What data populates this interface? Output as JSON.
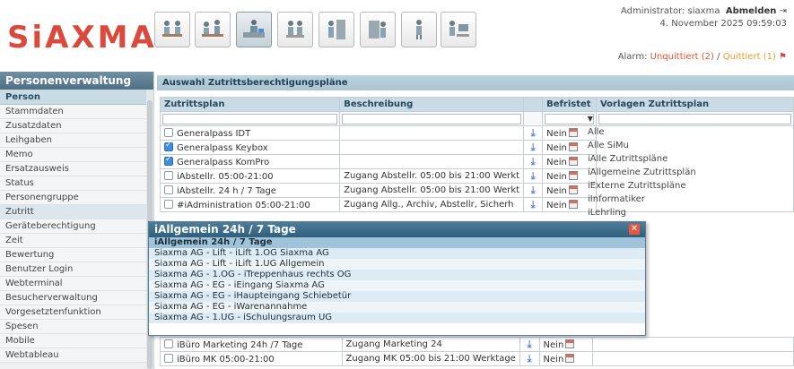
{
  "header": {
    "logo": "SiAXMA",
    "logo_mark": "®",
    "admin_label": "Administrator: siaxma",
    "logout_label": "Abmelden",
    "datetime": "4. November 2025 09:59:03",
    "alarm_label": "Alarm:",
    "alarm_unquitted": "Unquittiert (2)",
    "alarm_separator": "/",
    "alarm_quitted": "Quittiert (1)",
    "nav_icons": [
      "people-meeting-icon",
      "team-desk-icon",
      "receptionist-icon",
      "office-workers-icon",
      "door-access-icon",
      "worker-cabinet-icon",
      "standing-person-icon",
      "group-computer-icon"
    ]
  },
  "sidebar": {
    "title": "Personenverwaltung",
    "section": "Person",
    "items": [
      "Stammdaten",
      "Zusatzdaten",
      "Leihgaben",
      "Memo",
      "Ersatzausweis",
      "Status",
      "Personengruppe",
      "Zutritt",
      "Geräteberechtigung",
      "Zeit",
      "Bewertung",
      "Benutzer Login",
      "Webterminal",
      "Besucherverwaltung",
      "Vorgesetztenfunktion",
      "Spesen",
      "Mobile",
      "Webtableau"
    ],
    "selected": "Zutritt"
  },
  "main": {
    "title": "Auswahl Zutrittsberechtigungspläne",
    "columns": {
      "plan": "Zutrittsplan",
      "desc": "Beschreibung",
      "befristet": "Befristet",
      "vorlagen": "Vorlagen Zutrittsplan"
    },
    "rows": [
      {
        "checked": false,
        "plan": "Generalpass IDT",
        "desc": "",
        "befristet": "Nein"
      },
      {
        "checked": true,
        "plan": "Generalpass Keybox",
        "desc": "",
        "befristet": "Nein"
      },
      {
        "checked": true,
        "plan": "Generalpass KomPro",
        "desc": "",
        "befristet": "Nein"
      },
      {
        "checked": false,
        "plan": "iAbstellr. 05:00-21:00",
        "desc": "Zugang Abstellr. 05:00 bis 21:00 Werkt",
        "befristet": "Nein"
      },
      {
        "checked": false,
        "plan": "iAbstellr. 24 h / 7 Tage",
        "desc": "Zugang Abstellr. 05:00 bis 21:00 Werkt",
        "befristet": "Nein"
      },
      {
        "checked": false,
        "plan": "#iAdministration 05:00-21:00",
        "desc": "Zugang Allg., Archiv, Abstellr, Sicherh",
        "befristet": "Nein"
      }
    ],
    "bottom_rows": [
      {
        "checked": false,
        "plan": "iBüro Marketing 24h /7 Tage",
        "desc": "Zugang Marketing 24",
        "befristet": "Nein"
      },
      {
        "checked": false,
        "plan": "iBüro MK 05:00-21:00",
        "desc": "Zugang MK 05:00 bis 21:00 Werktage",
        "befristet": "Nein"
      }
    ],
    "vorlagen": [
      "Alle",
      "Alle SiMu",
      "iAlle Zutrittspläne",
      "iAllgemeine Zutrittsplän",
      "iExterne Zutrittspläne",
      "iInformatiker",
      "iLehrling"
    ]
  },
  "popup": {
    "title": "iAllgemein 24h / 7 Tage",
    "head": "iAllgemein 24h / 7 Tage",
    "items": [
      "Siaxma AG - Lift - iLift 1.OG Siaxma AG",
      "Siaxma AG - Lift - iLift 1.UG Allgemein",
      "Siaxma AG - 1.OG - iTreppenhaus rechts OG",
      "Siaxma AG - EG - iEingang Siaxma AG",
      "Siaxma AG - EG - iHaupteingang Schiebetür",
      "Siaxma AG - EG - iWarenannahme",
      "Siaxma AG - 1.UG - iSchulungsraum UG"
    ]
  },
  "colors": {
    "brand": "#d94a3d",
    "sidebar_header": "#4f6f84",
    "table_header": "#c9dbe5",
    "popup_header": "#2f5f7d",
    "alarm_unquitted": "#e2542b",
    "alarm_quitted": "#e89c2a"
  }
}
